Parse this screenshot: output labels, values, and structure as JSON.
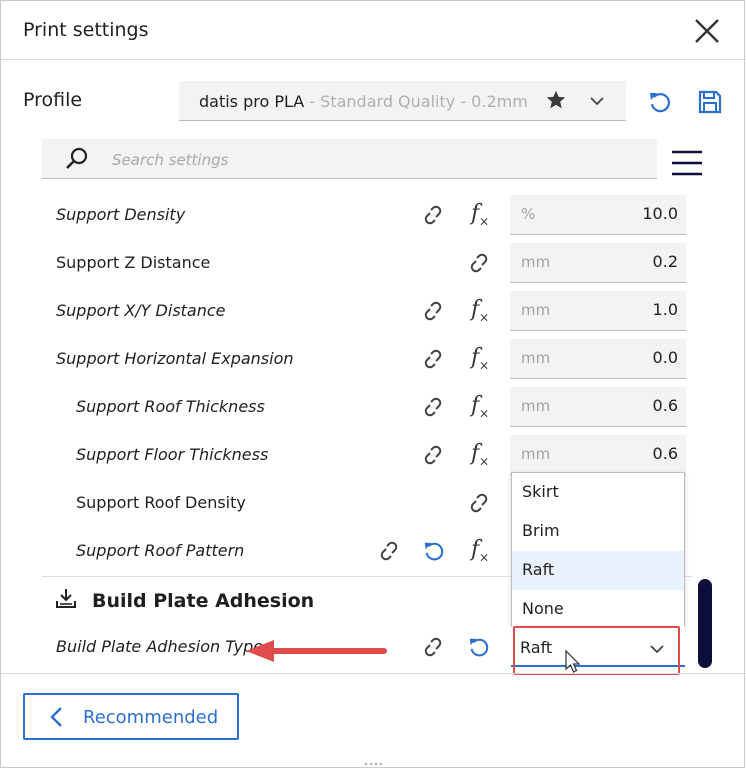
{
  "window": {
    "title": "Print settings"
  },
  "profile": {
    "label": "Profile",
    "name": "datis pro PLA",
    "quality": " - Standard Quality - 0.2mm"
  },
  "search": {
    "placeholder": "Search settings"
  },
  "settings": [
    {
      "label": "Support Density",
      "unit": "%",
      "value": "10.0"
    },
    {
      "label": "Support Z Distance",
      "unit": "mm",
      "value": "0.2"
    },
    {
      "label": "Support X/Y Distance",
      "unit": "mm",
      "value": "1.0"
    },
    {
      "label": "Support Horizontal Expansion",
      "unit": "mm",
      "value": "0.0"
    },
    {
      "label": "Support Roof Thickness",
      "unit": "mm",
      "value": "0.6"
    },
    {
      "label": "Support Floor Thickness",
      "unit": "mm",
      "value": "0.6"
    },
    {
      "label": "Support Roof Density"
    },
    {
      "label": "Support Roof Pattern"
    }
  ],
  "category": {
    "label": "Build Plate Adhesion"
  },
  "adhesion": {
    "label": "Build Plate Adhesion Type",
    "selected": "Raft",
    "options": [
      "Skirt",
      "Brim",
      "Raft",
      "None"
    ]
  },
  "footer": {
    "recommended_label": "Recommended"
  },
  "colors": {
    "accent": "#2b6fd1",
    "highlight": "#e04b4b",
    "scrollbar": "#0e0e3c",
    "field_bg": "#f3f3f3",
    "selected_option_bg": "#e9f1fe"
  },
  "icons": {
    "close": "close-icon",
    "star": "star-icon",
    "reset": "reset-icon",
    "save": "save-icon",
    "search": "search-icon",
    "menu": "hamburger-menu-icon",
    "link": "link-icon",
    "formula": "fx-icon",
    "category": "build-plate-adhesion-icon",
    "back": "chevron-left-icon"
  }
}
